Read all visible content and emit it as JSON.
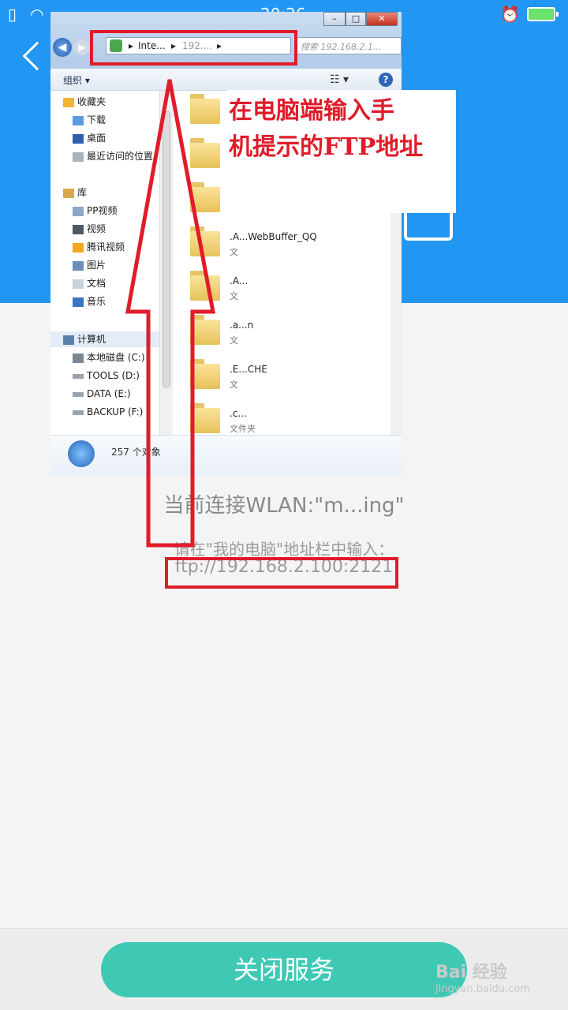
{
  "status_bar": {
    "time": "20:26"
  },
  "phone": {
    "wlan_text": "当前连接WLAN:\"m...ing\"",
    "hint_text": "请在\"我的电脑\"地址栏中输入：",
    "ftp_address": "ftp://192.168.2.100:2121",
    "close_button": "关闭服务"
  },
  "explorer": {
    "window_buttons": {
      "minimize": "–",
      "maximize": "□",
      "close": "✕"
    },
    "address_segments": [
      "Inte...",
      "192...."
    ],
    "search_placeholder": "搜索 192.168.2.1...",
    "organize_label": "组织 ▾",
    "nav": {
      "favorites_header": "收藏夹",
      "favorites": [
        "下载",
        "桌面",
        "最近访问的位置"
      ],
      "library_header": "库",
      "library": [
        "PP视频",
        "视频",
        "腾讯视频",
        "图片",
        "文档",
        "音乐"
      ],
      "computer_header": "计算机",
      "drives": [
        "本地磁盘 (C:)",
        "TOOLS (D:)",
        "DATA (E:)",
        "BACKUP (F:)"
      ]
    },
    "files": [
      {
        "name": "",
        "sub": ""
      },
      {
        "name": "",
        "sub": ""
      },
      {
        "name": "",
        "sub": ""
      },
      {
        "name": ".A...WebBuffer_QQ",
        "sub": "文"
      },
      {
        "name": ".A...",
        "sub": "文"
      },
      {
        "name": ".a...n",
        "sub": "文"
      },
      {
        "name": ".E...CHE",
        "sub": "文"
      },
      {
        "name": ".c...",
        "sub": "文件夹"
      }
    ],
    "object_count": "257 个对象"
  },
  "annotation": {
    "callout_line1": "在电脑端输入手",
    "callout_line2": "机提示的FTP地址"
  },
  "watermark": {
    "main": "Bai 经验",
    "sub": "jingyan.baidu.com"
  },
  "colors": {
    "accent_blue": "#2196f3",
    "button_teal": "#3fc9b5",
    "annotation_red": "#e01c2a"
  }
}
